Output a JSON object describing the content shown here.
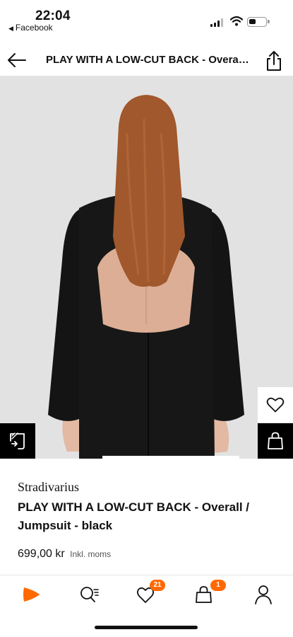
{
  "status_bar": {
    "time": "22:04",
    "back_app": "Facebook"
  },
  "nav": {
    "title": "PLAY WITH A LOW-CUT BACK - Overall / Jumpsuit - black"
  },
  "product": {
    "brand": "Stradivarius",
    "name": "PLAY WITH A LOW-CUT BACK - Overall / Jumpsuit - black",
    "price": "699,00 kr",
    "vat_note": "Inkl. moms"
  },
  "tabbar": {
    "wishlist_count": "21",
    "bag_count": "1"
  },
  "colors": {
    "accent": "#ff6900",
    "image_bg": "#e2e2e2"
  },
  "icons": [
    "back-arrow-icon",
    "share-icon",
    "heart-icon",
    "shopping-bag-icon",
    "size-fit-icon",
    "zalando-logo-icon",
    "search-icon",
    "user-icon"
  ]
}
